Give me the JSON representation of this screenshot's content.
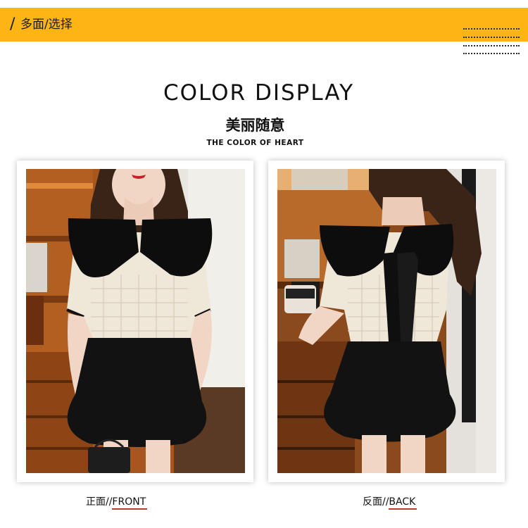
{
  "banner": {
    "slash": "/",
    "title": "多面/选择",
    "color": "#fdb515"
  },
  "heading": {
    "title_en": "COLOR DISPLAY",
    "title_cn": "美丽随意",
    "subtitle": "THE COLOR OF HEART"
  },
  "photos": [
    {
      "view": "front",
      "caption_cn": "正面/",
      "caption_en": "/FRONT",
      "colors": {
        "top": "#efe7d8",
        "collar": "#0d0d0d",
        "skirt": "#121212",
        "background": "#a9551e"
      }
    },
    {
      "view": "back",
      "caption_cn": "反面/",
      "caption_en": "/BACK",
      "colors": {
        "top": "#efe7d8",
        "collar": "#0d0d0d",
        "skirt": "#121212",
        "background": "#8a4a1e"
      }
    }
  ]
}
